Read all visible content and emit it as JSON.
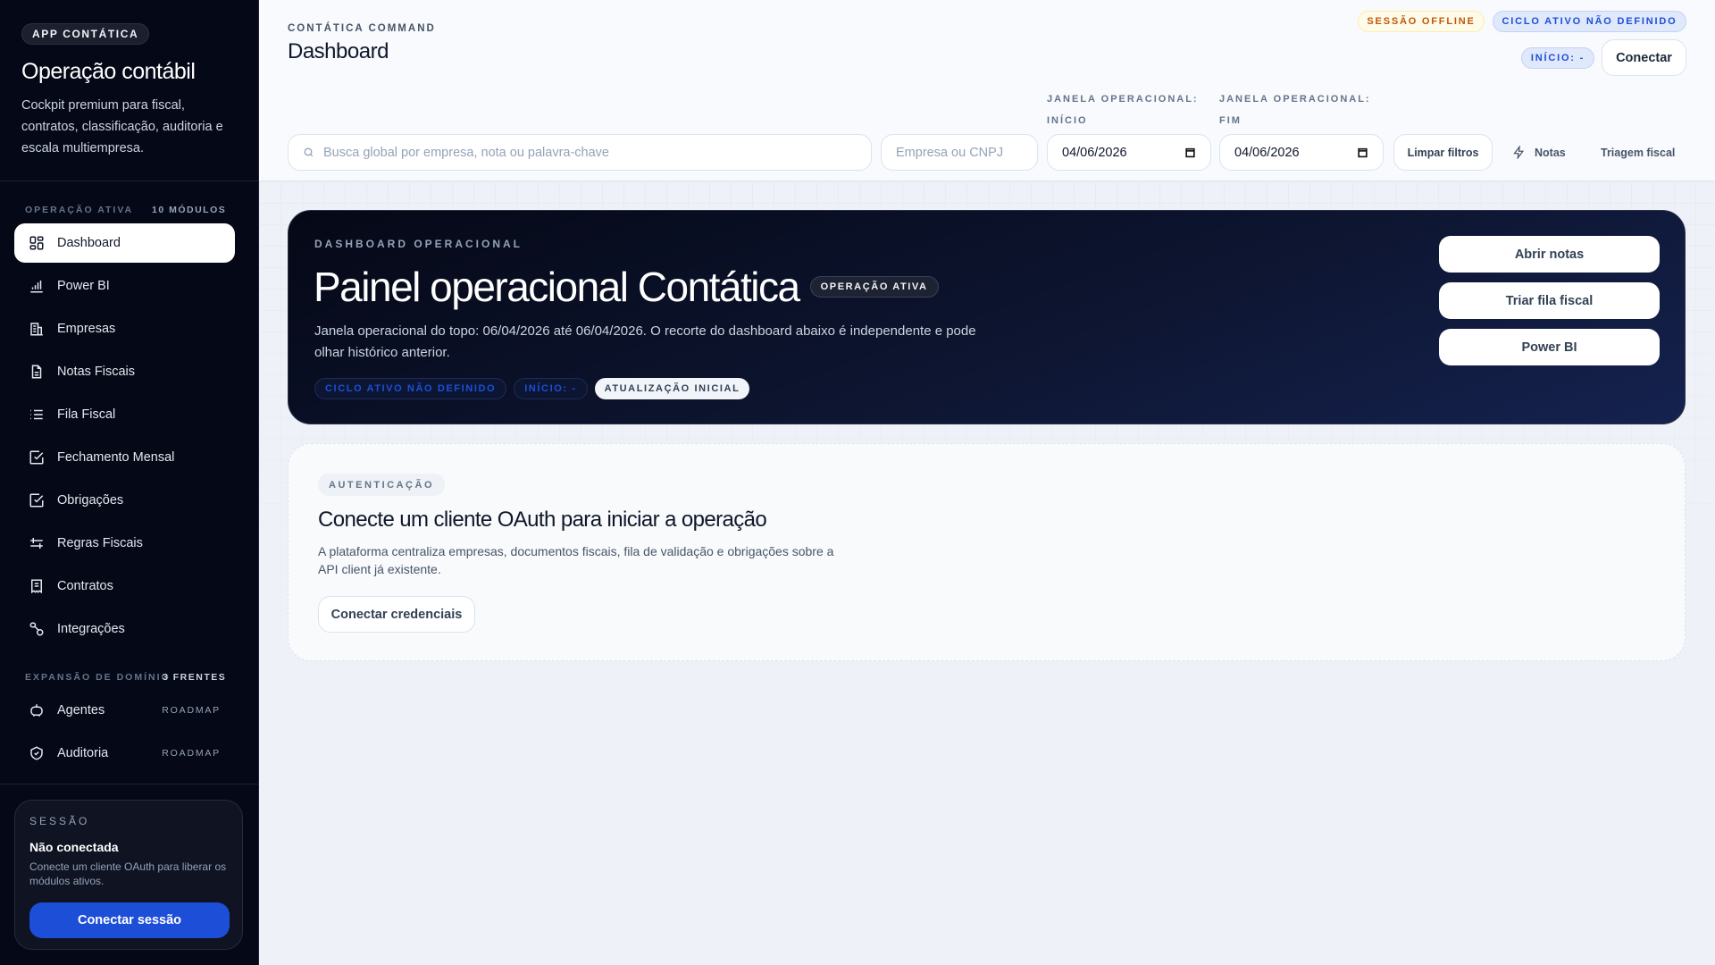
{
  "sidebar": {
    "brand": "APP CONTÁTICA",
    "title": "Operação contábil",
    "description": "Cockpit premium para fiscal, contratos, classificação, auditoria e escala multiempresa.",
    "section1": {
      "label": "OPERAÇÃO ATIVA",
      "count": "10 MÓDULOS"
    },
    "items": [
      {
        "label": "Dashboard",
        "icon": "grid-icon"
      },
      {
        "label": "Power BI",
        "icon": "bar-chart-icon"
      },
      {
        "label": "Empresas",
        "icon": "building-icon"
      },
      {
        "label": "Notas Fiscais",
        "icon": "file-text-icon"
      },
      {
        "label": "Fila Fiscal",
        "icon": "list-icon"
      },
      {
        "label": "Fechamento Mensal",
        "icon": "check-square-icon"
      },
      {
        "label": "Obrigações",
        "icon": "check-square-icon"
      },
      {
        "label": "Regras Fiscais",
        "icon": "sliders-icon"
      },
      {
        "label": "Contratos",
        "icon": "receipt-icon"
      },
      {
        "label": "Integrações",
        "icon": "link-icon"
      }
    ],
    "section2": {
      "label": "EXPANSÃO DE DOMÍNIO",
      "count": "3 FRENTES"
    },
    "roadmap": [
      {
        "label": "Agentes",
        "tag": "ROADMAP",
        "icon": "bot-icon"
      },
      {
        "label": "Auditoria",
        "tag": "ROADMAP",
        "icon": "shield-check-icon"
      }
    ],
    "session": {
      "label": "SESSÃO",
      "status": "Não conectada",
      "description": "Conecte um cliente OAuth para liberar os módulos ativos.",
      "button": "Conectar sessão"
    }
  },
  "header": {
    "kicker": "CONTÁTICA COMMAND",
    "title": "Dashboard",
    "badges": {
      "session": "SESSÃO OFFLINE",
      "cycle": "CICLO ATIVO NÃO DEFINIDO",
      "start": "INÍCIO: -"
    },
    "connect": "Conectar"
  },
  "filters": {
    "search_placeholder": "Busca global por empresa, nota ou palavra-chave",
    "company_placeholder": "Empresa ou CNPJ",
    "start_label": "JANELA OPERACIONAL:",
    "start_sub": "INÍCIO",
    "start_value": "04/06/2026",
    "end_label": "JANELA OPERACIONAL:",
    "end_sub": "FIM",
    "end_value": "04/06/2026",
    "clear": "Limpar filtros",
    "notes": "Notas",
    "triage": "Triagem fiscal"
  },
  "hero": {
    "kicker": "DASHBOARD OPERACIONAL",
    "title": "Painel operacional Contática",
    "badge": "OPERAÇÃO ATIVA",
    "description": "Janela operacional do topo: 06/04/2026 até 06/04/2026. O recorte do dashboard abaixo é independente e pode olhar histórico anterior.",
    "chips": [
      "CICLO ATIVO NÃO DEFINIDO",
      "INÍCIO: -",
      "ATUALIZAÇÃO INICIAL"
    ],
    "actions": [
      "Abrir notas",
      "Triar fila fiscal",
      "Power BI"
    ]
  },
  "auth": {
    "chip": "AUTENTICAÇÃO",
    "title": "Conecte um cliente OAuth para iniciar a operação",
    "description": "A plataforma centraliza empresas, documentos fiscais, fila de validação e obrigações sobre a API client já existente.",
    "button": "Conectar credenciais"
  }
}
